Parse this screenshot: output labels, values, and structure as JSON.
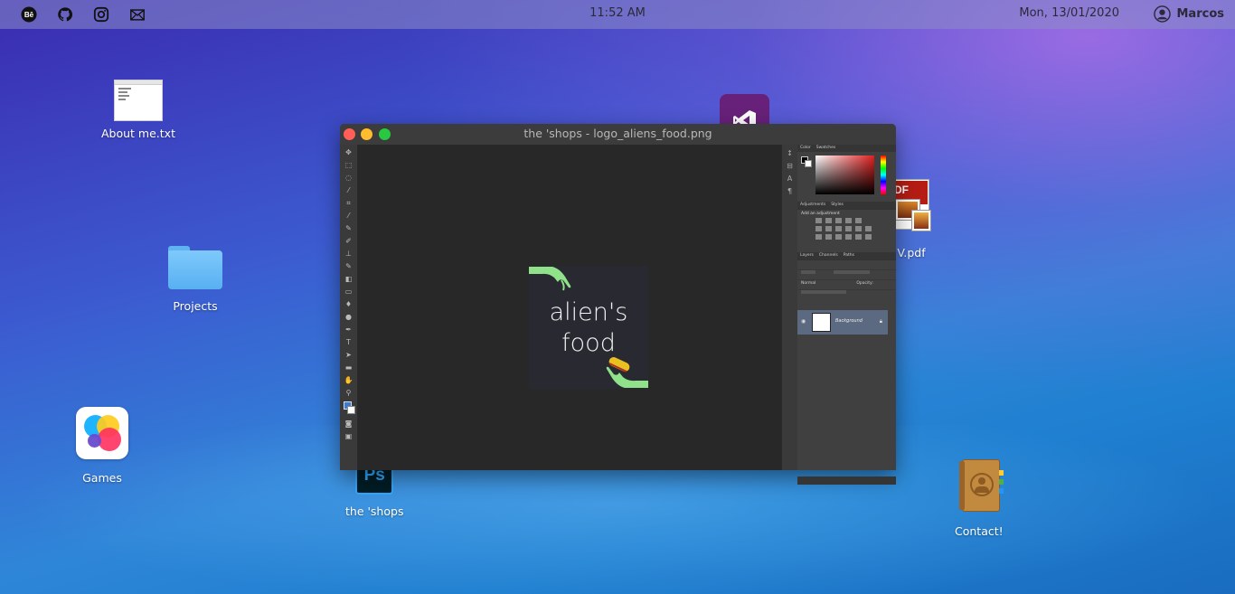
{
  "topbar": {
    "icons": [
      "behance-icon",
      "github-icon",
      "instagram-icon",
      "mail-icon"
    ],
    "time": "11:52 AM",
    "date": "Mon, 13/01/2020",
    "user": "Marcos"
  },
  "desktop": {
    "icons": [
      {
        "name": "about-me-file",
        "label": "About me.txt",
        "icon": "text-file-icon"
      },
      {
        "name": "projects-folder",
        "label": "Projects",
        "icon": "folder-icon"
      },
      {
        "name": "games-app",
        "label": "Games",
        "icon": "game-center-icon"
      },
      {
        "name": "shops-app",
        "label": "the 'shops",
        "icon": "photoshop-icon"
      },
      {
        "name": "visual-studio-app",
        "label": "",
        "icon": "visual-studio-icon"
      },
      {
        "name": "cv-pdf",
        "label": "V.pdf",
        "icon": "pdf-icon"
      },
      {
        "name": "contact-app",
        "label": "Contact!",
        "icon": "contacts-book-icon"
      }
    ]
  },
  "window": {
    "title": "the 'shops - logo_aliens_food.png",
    "artwork": {
      "line1": "alien's",
      "line2": "food"
    },
    "panels": {
      "color_tabs": [
        "Color",
        "Swatches"
      ],
      "adjust_tabs": [
        "Adjustments",
        "Styles"
      ],
      "adjust_title": "Add an adjustment",
      "layer_tabs": [
        "Layers",
        "Channels",
        "Paths"
      ],
      "blend_mode": "Normal",
      "opacity_label": "Opacity:",
      "layer_name": "Background"
    }
  },
  "colors": {
    "close": "#ff5f57",
    "minimize": "#febc2e",
    "maximize": "#28c840",
    "hand_green": "#8fe28a"
  }
}
